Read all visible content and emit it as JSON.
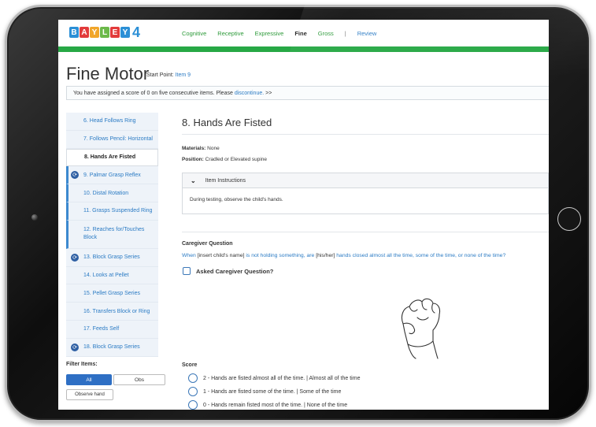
{
  "app": {
    "logo_letters": [
      "B",
      "A",
      "Y",
      "L",
      "E",
      "Y"
    ],
    "logo_number": "4",
    "logo_colors": [
      "#2b8fd6",
      "#e23b3b",
      "#f1a62b",
      "#6cb94a",
      "#e23b3b",
      "#2b8fd6"
    ]
  },
  "nav": {
    "cognitive": "Cognitive",
    "receptive": "Receptive",
    "expressive": "Expressive",
    "fine": "Fine",
    "gross": "Gross",
    "separator": "|",
    "review": "Review"
  },
  "colors": {
    "accent_green": "#27a845",
    "link_blue": "#2b7bc4",
    "primary_button": "#2e6fc4"
  },
  "page": {
    "title": "Fine Motor",
    "start_label": "Start Point: ",
    "start_value": "Item 9"
  },
  "alert": {
    "text": "You have assigned a score of 0 on five consecutive items. Please ",
    "link": "discontinue.",
    "suffix": " >>"
  },
  "sidebar": {
    "items": [
      {
        "label": "6. Head Follows Ring",
        "icon": ""
      },
      {
        "label": "7. Follows Pencil: Horizontal",
        "icon": ""
      },
      {
        "label": "8. Hands Are Fisted",
        "icon": ""
      },
      {
        "label": "9. Palmar Grasp Reflex",
        "icon": "refresh-icon"
      },
      {
        "label": "10. Distal Rotation",
        "icon": ""
      },
      {
        "label": "11. Grasps Suspended Ring",
        "icon": ""
      },
      {
        "label": "12. Reaches for/Touches Block",
        "icon": ""
      },
      {
        "label": "13. Block Grasp Series",
        "icon": "refresh-icon"
      },
      {
        "label": "14. Looks at Pellet",
        "icon": ""
      },
      {
        "label": "15. Pellet Grasp Series",
        "icon": ""
      },
      {
        "label": "16. Transfers Block or Ring",
        "icon": ""
      },
      {
        "label": "17. Feeds Self",
        "icon": ""
      },
      {
        "label": "18. Block Grasp Series",
        "icon": "refresh-icon"
      }
    ],
    "filter_label": "Filter Items:",
    "filter_all": "All",
    "filter_obs": "Obs",
    "filter_observe_hand": "Observe hand"
  },
  "item": {
    "title": "8. Hands Are Fisted",
    "materials_label": "Materials:",
    "materials_value": " None",
    "position_label": "Position:",
    "position_value": " Cradled or Elevated supine",
    "instructions_header": "Item Instructions",
    "instructions_body": "During testing, observe the child's hands.",
    "caregiver_title": "Caregiver Question",
    "caregiver_q1": "When ",
    "caregiver_q2": "[insert child's name]",
    "caregiver_q3": " is not holding something, are ",
    "caregiver_q4": "[his/her]",
    "caregiver_q5": " hands closed almost all the time, some of the time, or none of the time?",
    "asked_label": "Asked Caregiver Question?",
    "score_label": "Score",
    "score_options": [
      "2 - Hands are fisted almost all of the time. | Almost all of the time",
      "1 - Hands are fisted some of the time. | Some of the time",
      "0 - Hands remain fisted most of the time. | None of the time"
    ]
  }
}
